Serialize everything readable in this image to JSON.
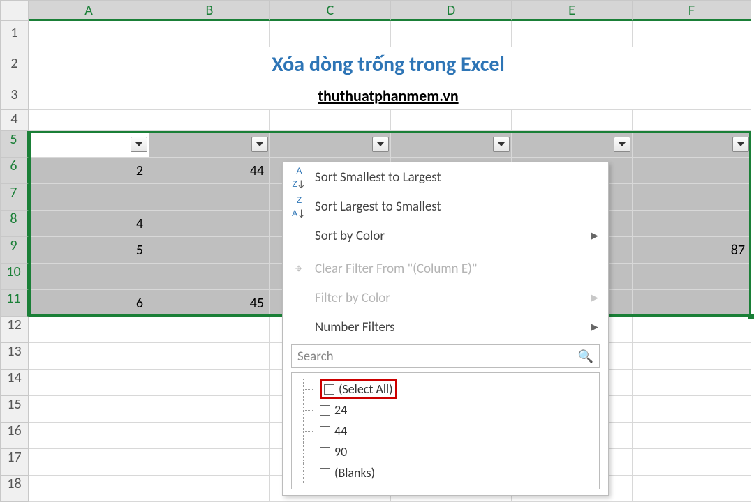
{
  "columns": [
    "A",
    "B",
    "C",
    "D",
    "E",
    "F"
  ],
  "rows": [
    "1",
    "2",
    "3",
    "4",
    "5",
    "6",
    "7",
    "8",
    "9",
    "10",
    "11",
    "12",
    "13",
    "14",
    "15",
    "16",
    "17",
    "18"
  ],
  "title": "Xóa dòng trống trong Excel",
  "subtitle": "thuthuatphanmem.vn",
  "cells": {
    "A6": "2",
    "B6": "44",
    "A8": "4",
    "A9": "5",
    "F9": "87",
    "A11": "6",
    "B11": "45"
  },
  "menu": {
    "sort_asc": "Sort Smallest to Largest",
    "sort_desc": "Sort Largest to Smallest",
    "sort_color": "Sort by Color",
    "clear_filter": "Clear Filter From \"(Column E)\"",
    "filter_color": "Filter by Color",
    "number_filters": "Number Filters",
    "search_placeholder": "Search",
    "tree": {
      "select_all": "(Select All)",
      "v1": "24",
      "v2": "44",
      "v3": "90",
      "blanks": "(Blanks)"
    }
  },
  "row_heights": {
    "1": 38,
    "2": 50,
    "3": 40,
    "4": 30,
    "5": 38
  }
}
